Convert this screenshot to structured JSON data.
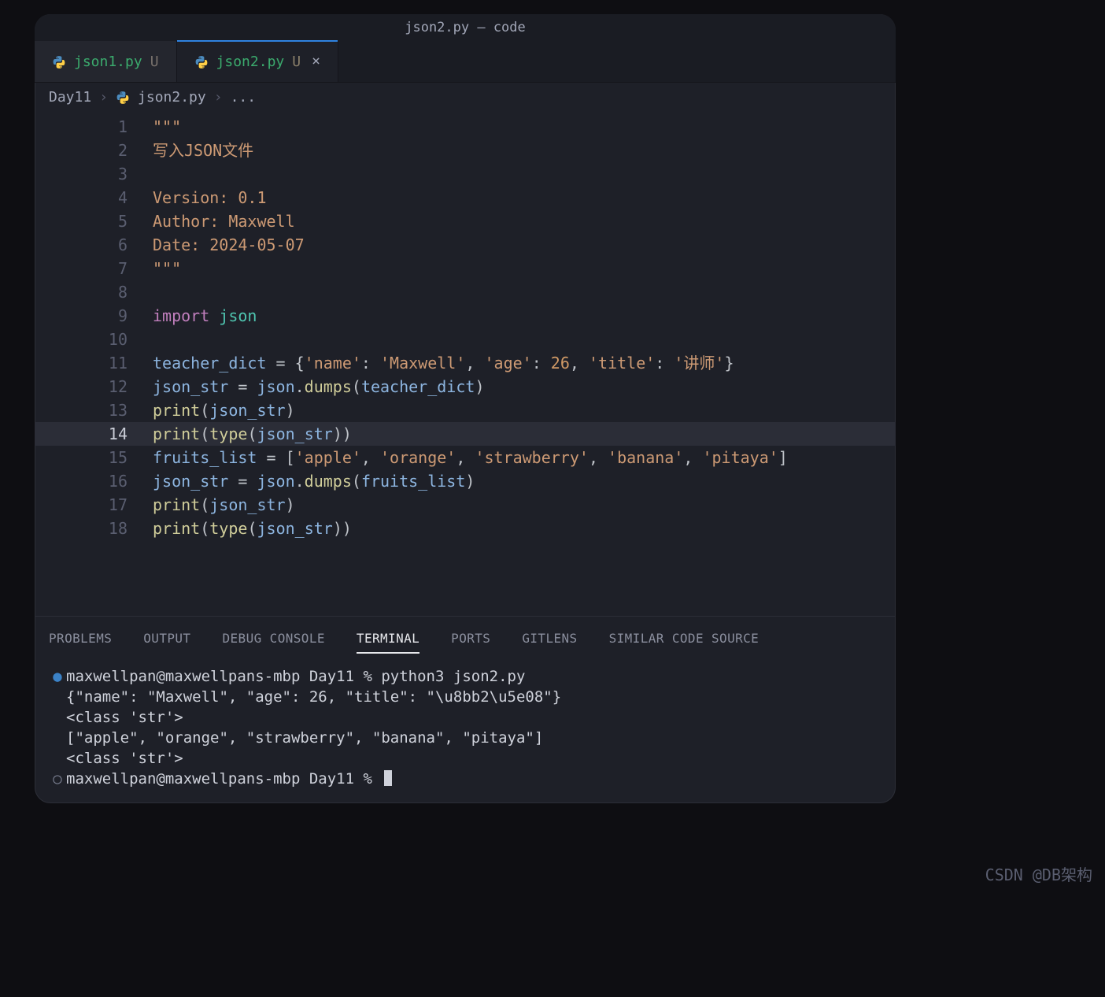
{
  "window": {
    "title": "json2.py — code"
  },
  "tabs": [
    {
      "filename": "json1.py",
      "modified_flag": "U",
      "active": false,
      "closable": false
    },
    {
      "filename": "json2.py",
      "modified_flag": "U",
      "active": true,
      "closable": true,
      "close_glyph": "×"
    }
  ],
  "breadcrumb": {
    "segments": [
      "Day11",
      "json2.py",
      "..."
    ],
    "separator": "›"
  },
  "editor": {
    "highlighted_line": 14,
    "lines": [
      {
        "n": 1,
        "tokens": [
          [
            "str",
            "\"\"\""
          ]
        ]
      },
      {
        "n": 2,
        "tokens": [
          [
            "str",
            "写入JSON文件"
          ]
        ]
      },
      {
        "n": 3,
        "tokens": []
      },
      {
        "n": 4,
        "tokens": [
          [
            "str",
            "Version: 0.1"
          ]
        ]
      },
      {
        "n": 5,
        "tokens": [
          [
            "str",
            "Author: Maxwell"
          ]
        ]
      },
      {
        "n": 6,
        "tokens": [
          [
            "str",
            "Date: 2024-05-07"
          ]
        ]
      },
      {
        "n": 7,
        "tokens": [
          [
            "str",
            "\"\"\""
          ]
        ]
      },
      {
        "n": 8,
        "tokens": []
      },
      {
        "n": 9,
        "tokens": [
          [
            "kw",
            "import"
          ],
          [
            "p",
            " "
          ],
          [
            "mod",
            "json"
          ]
        ]
      },
      {
        "n": 10,
        "tokens": []
      },
      {
        "n": 11,
        "tokens": [
          [
            "var",
            "teacher_dict"
          ],
          [
            "p",
            " = {"
          ],
          [
            "str",
            "'name'"
          ],
          [
            "p",
            ": "
          ],
          [
            "str",
            "'Maxwell'"
          ],
          [
            "p",
            ", "
          ],
          [
            "str",
            "'age'"
          ],
          [
            "p",
            ": "
          ],
          [
            "num",
            "26"
          ],
          [
            "p",
            ", "
          ],
          [
            "str",
            "'title'"
          ],
          [
            "p",
            ": "
          ],
          [
            "str",
            "'讲师'"
          ],
          [
            "p",
            "}"
          ]
        ]
      },
      {
        "n": 12,
        "tokens": [
          [
            "var",
            "json_str"
          ],
          [
            "p",
            " = "
          ],
          [
            "var",
            "json"
          ],
          [
            "p",
            "."
          ],
          [
            "fn",
            "dumps"
          ],
          [
            "p",
            "("
          ],
          [
            "var",
            "teacher_dict"
          ],
          [
            "p",
            ")"
          ]
        ]
      },
      {
        "n": 13,
        "tokens": [
          [
            "fn",
            "print"
          ],
          [
            "p",
            "("
          ],
          [
            "var",
            "json_str"
          ],
          [
            "p",
            ")"
          ]
        ]
      },
      {
        "n": 14,
        "tokens": [
          [
            "fn",
            "print"
          ],
          [
            "p",
            "("
          ],
          [
            "fn",
            "type"
          ],
          [
            "p",
            "("
          ],
          [
            "var",
            "json_str"
          ],
          [
            "p",
            "))"
          ]
        ]
      },
      {
        "n": 15,
        "tokens": [
          [
            "var",
            "fruits_list"
          ],
          [
            "p",
            " = ["
          ],
          [
            "str",
            "'apple'"
          ],
          [
            "p",
            ", "
          ],
          [
            "str",
            "'orange'"
          ],
          [
            "p",
            ", "
          ],
          [
            "str",
            "'strawberry'"
          ],
          [
            "p",
            ", "
          ],
          [
            "str",
            "'banana'"
          ],
          [
            "p",
            ", "
          ],
          [
            "str",
            "'pitaya'"
          ],
          [
            "p",
            "]"
          ]
        ]
      },
      {
        "n": 16,
        "tokens": [
          [
            "var",
            "json_str"
          ],
          [
            "p",
            " = "
          ],
          [
            "var",
            "json"
          ],
          [
            "p",
            "."
          ],
          [
            "fn",
            "dumps"
          ],
          [
            "p",
            "("
          ],
          [
            "var",
            "fruits_list"
          ],
          [
            "p",
            ")"
          ]
        ]
      },
      {
        "n": 17,
        "tokens": [
          [
            "fn",
            "print"
          ],
          [
            "p",
            "("
          ],
          [
            "var",
            "json_str"
          ],
          [
            "p",
            ")"
          ]
        ]
      },
      {
        "n": 18,
        "tokens": [
          [
            "fn",
            "print"
          ],
          [
            "p",
            "("
          ],
          [
            "fn",
            "type"
          ],
          [
            "p",
            "("
          ],
          [
            "var",
            "json_str"
          ],
          [
            "p",
            "))"
          ]
        ]
      }
    ]
  },
  "panel": {
    "tabs": [
      "PROBLEMS",
      "OUTPUT",
      "DEBUG CONSOLE",
      "TERMINAL",
      "PORTS",
      "GITLENS",
      "SIMILAR CODE SOURCE"
    ],
    "active_tab": "TERMINAL",
    "terminal_lines": [
      {
        "bullet": "blue",
        "text": "maxwellpan@maxwellpans-mbp Day11 % python3 json2.py"
      },
      {
        "bullet": "",
        "text": "{\"name\": \"Maxwell\", \"age\": 26, \"title\": \"\\u8bb2\\u5e08\"}"
      },
      {
        "bullet": "",
        "text": "<class 'str'>"
      },
      {
        "bullet": "",
        "text": "[\"apple\", \"orange\", \"strawberry\", \"banana\", \"pitaya\"]"
      },
      {
        "bullet": "",
        "text": "<class 'str'>"
      },
      {
        "bullet": "grey",
        "text": "maxwellpan@maxwellpans-mbp Day11 % ",
        "cursor": true
      }
    ]
  },
  "watermark": "CSDN @DB架构"
}
